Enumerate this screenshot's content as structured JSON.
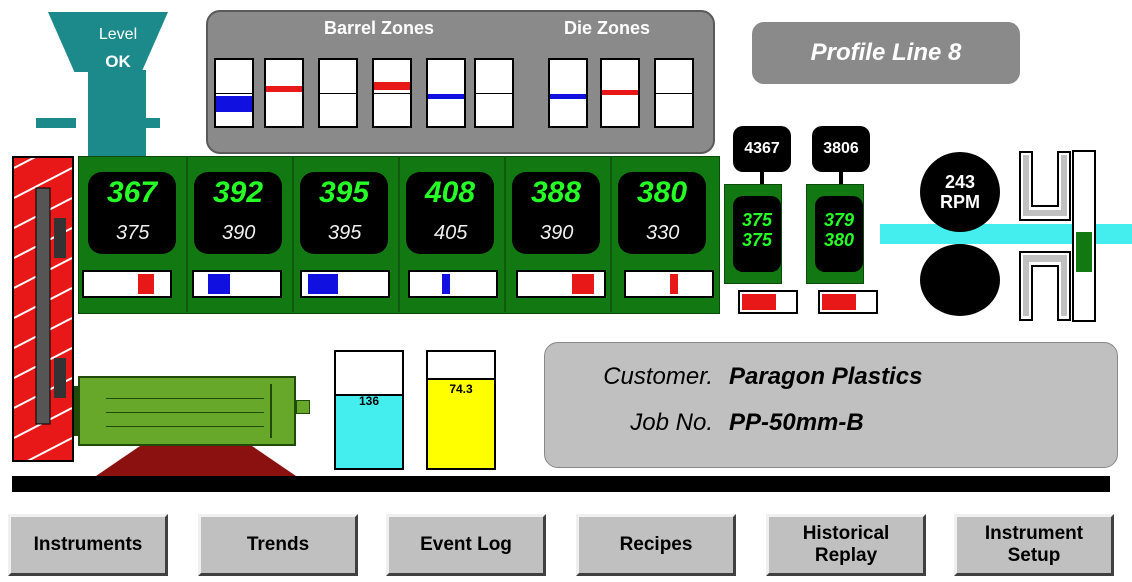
{
  "hopper": {
    "label": "Level",
    "status": "OK"
  },
  "zones": {
    "barrel_title": "Barrel Zones",
    "die_title": "Die Zones"
  },
  "title": "Profile Line 8",
  "barrel_zones": [
    {
      "pv": "367",
      "sp": "375"
    },
    {
      "pv": "392",
      "sp": "390"
    },
    {
      "pv": "395",
      "sp": "395"
    },
    {
      "pv": "408",
      "sp": "405"
    },
    {
      "pv": "388",
      "sp": "390"
    },
    {
      "pv": "380",
      "sp": "330"
    }
  ],
  "die_zones": [
    {
      "pressure": "4367",
      "pv": "375",
      "sp": "375"
    },
    {
      "pressure": "3806",
      "pv": "379",
      "sp": "380"
    }
  ],
  "puller": {
    "speed": "243",
    "unit": "RPM"
  },
  "tanks": [
    {
      "value": "136",
      "color": "#44eeee",
      "level_fraction": 0.62
    },
    {
      "value": "74.3",
      "color": "#ffff00",
      "level_fraction": 0.74
    }
  ],
  "customer": {
    "customer_label": "Customer.",
    "customer_value": "Paragon Plastics",
    "job_label": "Job No.",
    "job_value": "PP-50mm-B"
  },
  "nav": [
    {
      "label": "Instruments"
    },
    {
      "label": "Trends"
    },
    {
      "label": "Event Log"
    },
    {
      "label": "Recipes"
    },
    {
      "label": "Historical\nReplay"
    },
    {
      "label": "Instrument\nSetup"
    }
  ],
  "colors": {
    "barrel": "#127812",
    "display_text": "#26ff26",
    "hot": "#e81818",
    "cold": "#1010e0"
  }
}
